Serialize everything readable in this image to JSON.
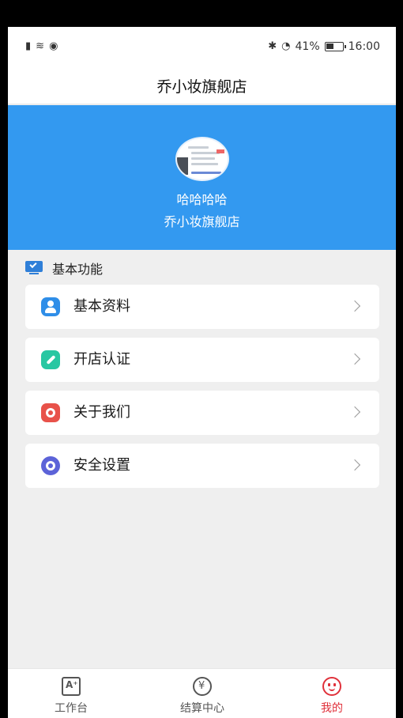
{
  "status_bar": {
    "time": "16:00",
    "battery": "41%",
    "left_icons": [
      "sim-alert-icon",
      "wifi-icon",
      "eye-icon"
    ],
    "right_icons": [
      "bluetooth-icon",
      "data-speed-icon",
      "battery-icon"
    ]
  },
  "header": {
    "title": "乔小妆旗舰店"
  },
  "profile": {
    "name": "哈哈哈哈",
    "shop_name": "乔小妆旗舰店",
    "background_color": "#3399f0"
  },
  "section": {
    "title": "基本功能",
    "icon": "monitor-icon"
  },
  "menu": {
    "items": [
      {
        "label": "基本资料",
        "icon": "profile-icon",
        "color": "#2f8ee8"
      },
      {
        "label": "开店认证",
        "icon": "pen-icon",
        "color": "#28c7a2"
      },
      {
        "label": "关于我们",
        "icon": "about-icon",
        "color": "#e8524a"
      },
      {
        "label": "安全设置",
        "icon": "security-icon",
        "color": "#5c63d8"
      }
    ]
  },
  "bottom_nav": {
    "items": [
      {
        "label": "工作台",
        "icon": "workbench-icon",
        "active": false
      },
      {
        "label": "结算中心",
        "icon": "yen-icon",
        "active": false
      },
      {
        "label": "我的",
        "icon": "smiley-icon",
        "active": true
      }
    ],
    "active_color": "#e0303a"
  }
}
